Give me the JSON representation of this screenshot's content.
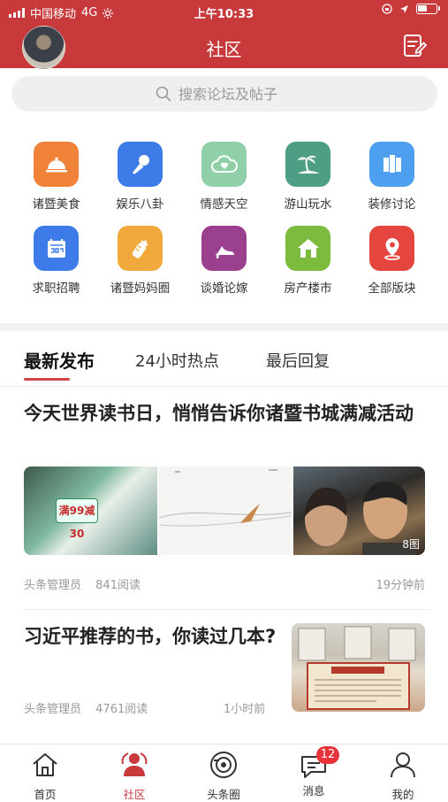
{
  "status_bar": {
    "carrier": "中国移动",
    "network": "4G",
    "time": "上午10:33"
  },
  "header": {
    "title": "社区",
    "edit_icon": "edit-note-icon",
    "bg_color": "#c8393c"
  },
  "search": {
    "placeholder": "搜索论坛及帖子",
    "icon": "search-icon"
  },
  "categories": [
    {
      "label": "诸暨美食",
      "icon": "food-cloche-icon",
      "color": "#f0823a"
    },
    {
      "label": "娱乐八卦",
      "icon": "microphone-icon",
      "color": "#3d7be8"
    },
    {
      "label": "情感天空",
      "icon": "heart-cloud-icon",
      "color": "#8fd0a8"
    },
    {
      "label": "游山玩水",
      "icon": "palm-island-icon",
      "color": "#4e9e86"
    },
    {
      "label": "装修讨论",
      "icon": "building-icon",
      "color": "#4d9ff0"
    },
    {
      "label": "求职招聘",
      "icon": "job-card-icon",
      "color": "#3d7be8"
    },
    {
      "label": "诸暨妈妈圈",
      "icon": "baby-bottle-icon",
      "color": "#f2a93b"
    },
    {
      "label": "谈婚论嫁",
      "icon": "high-heel-icon",
      "color": "#9b3f8f"
    },
    {
      "label": "房产楼市",
      "icon": "house-icon",
      "color": "#7dbb3f"
    },
    {
      "label": "全部版块",
      "icon": "location-pin-icon",
      "color": "#e4463f"
    }
  ],
  "tabs": [
    {
      "label": "最新发布",
      "active": true
    },
    {
      "label": "24小时热点",
      "active": false
    },
    {
      "label": "最后回复",
      "active": false
    }
  ],
  "posts": [
    {
      "title": "今天世界读书日，悄悄告诉你诸暨书城满减活动",
      "image_promo_text": "满99减30",
      "image_count": "8图",
      "author": "头条管理员",
      "reads": "841阅读",
      "time": "19分钟前"
    },
    {
      "title": "习近平推荐的书，你读过几本?",
      "author": "头条管理员",
      "reads": "4761阅读",
      "time": "1小时前"
    }
  ],
  "tabbar": [
    {
      "label": "首页",
      "icon": "home-icon",
      "active": false
    },
    {
      "label": "社区",
      "icon": "community-icon",
      "active": true
    },
    {
      "label": "头条圈",
      "icon": "headline-circle-icon",
      "active": false
    },
    {
      "label": "消息",
      "icon": "message-icon",
      "active": false,
      "badge": "12"
    },
    {
      "label": "我的",
      "icon": "profile-icon",
      "active": false
    }
  ]
}
